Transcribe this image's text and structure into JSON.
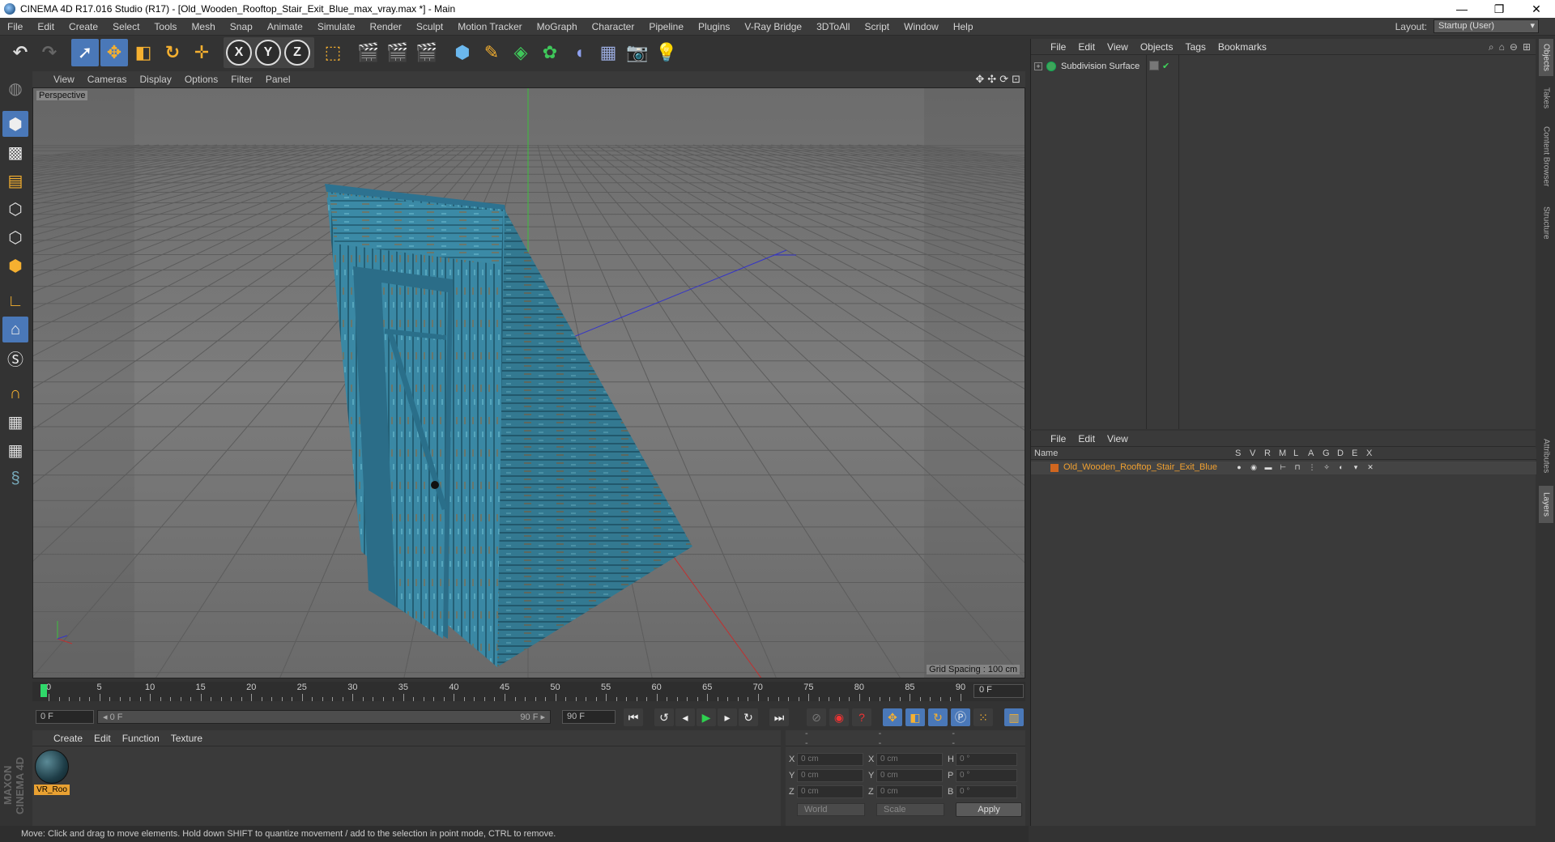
{
  "window": {
    "title": "CINEMA 4D R17.016 Studio (R17) - [Old_Wooden_Rooftop_Stair_Exit_Blue_max_vray.max *] - Main",
    "controls": [
      "—",
      "❐",
      "✕"
    ]
  },
  "menubar": {
    "items": [
      "File",
      "Edit",
      "Create",
      "Select",
      "Tools",
      "Mesh",
      "Snap",
      "Animate",
      "Simulate",
      "Render",
      "Sculpt",
      "Motion Tracker",
      "MoGraph",
      "Character",
      "Pipeline",
      "Plugins",
      "V-Ray Bridge",
      "3DToAll",
      "Script",
      "Window",
      "Help"
    ],
    "layout_label": "Layout:",
    "layout_value": "Startup (User)"
  },
  "toolbar": {
    "axis": [
      "X",
      "Y",
      "Z"
    ]
  },
  "viewport": {
    "menu": [
      "View",
      "Cameras",
      "Display",
      "Options",
      "Filter",
      "Panel"
    ],
    "label": "Perspective",
    "grid_info": "Grid Spacing : 100 cm"
  },
  "timeline": {
    "ticks": [
      "0",
      "5",
      "10",
      "15",
      "20",
      "25",
      "30",
      "35",
      "40",
      "45",
      "50",
      "55",
      "60",
      "65",
      "70",
      "75",
      "80",
      "85",
      "90"
    ],
    "current_frame": "0 F",
    "start_field": "0 F",
    "slider_left": "◂ 0 F",
    "slider_right": "90 F ▸",
    "end_field": "90 F"
  },
  "materials": {
    "menu": [
      "Create",
      "Edit",
      "Function",
      "Texture"
    ],
    "items": [
      {
        "name": "VR_Roo"
      }
    ]
  },
  "coords": {
    "headers": [
      "--",
      "--",
      "--"
    ],
    "rows": [
      {
        "a": "X",
        "av": "0 cm",
        "b": "X",
        "bv": "0 cm",
        "c": "H",
        "cv": "0 °"
      },
      {
        "a": "Y",
        "av": "0 cm",
        "b": "Y",
        "bv": "0 cm",
        "c": "P",
        "cv": "0 °"
      },
      {
        "a": "Z",
        "av": "0 cm",
        "b": "Z",
        "bv": "0 cm",
        "c": "B",
        "cv": "0 °"
      }
    ],
    "world": "World",
    "scale": "Scale",
    "apply": "Apply"
  },
  "status": "Move: Click and drag to move elements. Hold down SHIFT to quantize movement / add to the selection in point mode, CTRL to remove.",
  "objects": {
    "menu": [
      "File",
      "Edit",
      "View",
      "Objects",
      "Tags",
      "Bookmarks"
    ],
    "items": [
      {
        "name": "Subdivision Surface"
      }
    ]
  },
  "layers": {
    "menu": [
      "File",
      "Edit",
      "View"
    ],
    "name_header": "Name",
    "columns": [
      "S",
      "V",
      "R",
      "M",
      "L",
      "A",
      "G",
      "D",
      "E",
      "X"
    ],
    "items": [
      {
        "name": "Old_Wooden_Rooftop_Stair_Exit_Blue"
      }
    ]
  },
  "right_tabs": [
    "Objects",
    "Takes",
    "Content Browser",
    "Structure",
    "Attributes",
    "Layers"
  ],
  "brand": "MAXON CINEMA 4D",
  "colors": {
    "accent": "#4a78b8",
    "layer_name": "#f0a030",
    "material_label": "#e9a132",
    "wood": "#3a8ba8"
  }
}
